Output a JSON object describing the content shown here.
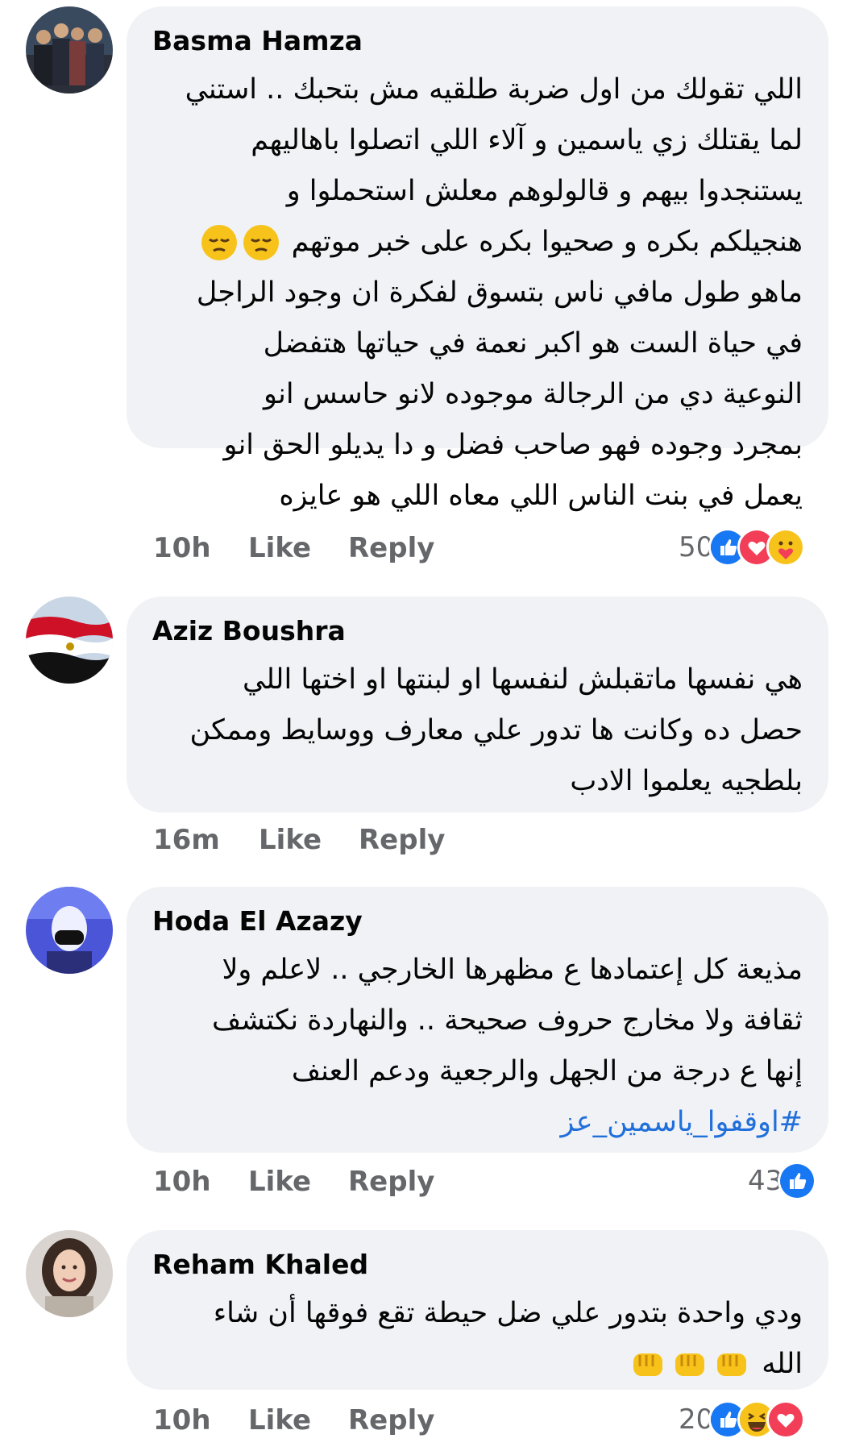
{
  "comments": [
    {
      "author": "Basma Hamza",
      "lines": [
        "اللي تقولك من اول ضربة طلقيه مش بتحبك .. استني",
        "لما يقتلك زي ياسمين و آلاء اللي اتصلوا باهاليهم",
        "يستنجدوا بيهم و قالولوهم معلش استحملوا و",
        "هنجيلكم بكره و صحيوا بكره على خبر موتهم",
        "ماهو طول مافي ناس بتسوق لفكرة ان وجود الراجل",
        "في حياة الست هو اكبر نعمة في حياتها هتفضل",
        "النوعية دي من الرجالة موجوده لانو حاسس انو",
        "بمجرد وجوده فهو صاحب فضل و دا يديلو الحق انو",
        "يعمل في بنت الناس اللي معاه اللي هو عايزه"
      ],
      "time": "10h",
      "like": "Like",
      "reply": "Reply",
      "reaction_count": "50",
      "reactions": [
        "like-icon",
        "love-icon",
        "care-icon"
      ]
    },
    {
      "author": "Aziz Boushra",
      "lines": [
        "هي نفسها ماتقبلش لنفسها او لبنتها او اختها اللي",
        "حصل ده وكانت ها تدور علي معارف ووسايط وممكن",
        "بلطجيه يعلموا الادب"
      ],
      "time": "16m",
      "like": "Like",
      "reply": "Reply"
    },
    {
      "author": "Hoda El Azazy",
      "lines": [
        "مذيعة كل إعتمادها ع مظهرها الخارجي .. لاعلم ولا",
        "ثقافة ولا مخارج حروف صحيحة .. والنهاردة نكتشف",
        "إنها ع درجة من الجهل والرجعية ودعم العنف"
      ],
      "hashtag": "#اوقفوا_ياسمين_عز",
      "time": "10h",
      "like": "Like",
      "reply": "Reply",
      "reaction_count": "43",
      "reactions": [
        "like-icon"
      ]
    },
    {
      "author": "Reham Khaled",
      "lines": [
        "ودي واحدة بتدور علي ضل حيطة تقع فوقها أن شاء",
        "الله"
      ],
      "time": "10h",
      "like": "Like",
      "reply": "Reply",
      "reaction_count": "20",
      "reactions": [
        "like-icon",
        "haha-icon",
        "love-icon"
      ]
    }
  ],
  "colors": {
    "bubble": "#f0f2f5",
    "meta_text": "#65676b",
    "hashtag": "#216fdb",
    "like_blue": "#1877f2",
    "love_red": "#f33e58",
    "emoji_yellow": "#f7c31b"
  }
}
